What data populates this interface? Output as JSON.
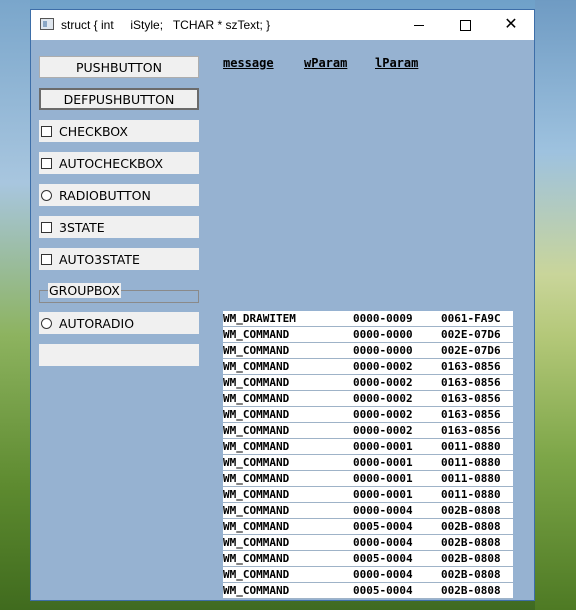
{
  "window": {
    "title": "struct { int     iStyle;   TCHAR * szText; }"
  },
  "controls": [
    {
      "type": "pushbutton",
      "label": "PUSHBUTTON"
    },
    {
      "type": "defpushbutton",
      "label": "DEFPUSHBUTTON"
    },
    {
      "type": "checkbox",
      "label": "CHECKBOX"
    },
    {
      "type": "checkbox",
      "label": "AUTOCHECKBOX"
    },
    {
      "type": "radio",
      "label": "RADIOBUTTON"
    },
    {
      "type": "checkbox",
      "label": "3STATE"
    },
    {
      "type": "checkbox",
      "label": "AUTO3STATE"
    },
    {
      "type": "groupbox",
      "label": "GROUPBOX"
    },
    {
      "type": "radio",
      "label": "AUTORADIO"
    },
    {
      "type": "ownerdraw",
      "label": ""
    }
  ],
  "log": {
    "headers": {
      "message": "message",
      "wparam": "wParam",
      "lparam": "lParam"
    },
    "rows": [
      {
        "message": "WM_DRAWITEM",
        "wparam": "0000-0009",
        "lparam": "0061-FA9C"
      },
      {
        "message": "WM_COMMAND",
        "wparam": "0000-0000",
        "lparam": "002E-07D6"
      },
      {
        "message": "WM_COMMAND",
        "wparam": "0000-0000",
        "lparam": "002E-07D6"
      },
      {
        "message": "WM_COMMAND",
        "wparam": "0000-0002",
        "lparam": "0163-0856"
      },
      {
        "message": "WM_COMMAND",
        "wparam": "0000-0002",
        "lparam": "0163-0856"
      },
      {
        "message": "WM_COMMAND",
        "wparam": "0000-0002",
        "lparam": "0163-0856"
      },
      {
        "message": "WM_COMMAND",
        "wparam": "0000-0002",
        "lparam": "0163-0856"
      },
      {
        "message": "WM_COMMAND",
        "wparam": "0000-0002",
        "lparam": "0163-0856"
      },
      {
        "message": "WM_COMMAND",
        "wparam": "0000-0001",
        "lparam": "0011-0880"
      },
      {
        "message": "WM_COMMAND",
        "wparam": "0000-0001",
        "lparam": "0011-0880"
      },
      {
        "message": "WM_COMMAND",
        "wparam": "0000-0001",
        "lparam": "0011-0880"
      },
      {
        "message": "WM_COMMAND",
        "wparam": "0000-0001",
        "lparam": "0011-0880"
      },
      {
        "message": "WM_COMMAND",
        "wparam": "0000-0004",
        "lparam": "002B-0808"
      },
      {
        "message": "WM_COMMAND",
        "wparam": "0005-0004",
        "lparam": "002B-0808"
      },
      {
        "message": "WM_COMMAND",
        "wparam": "0000-0004",
        "lparam": "002B-0808"
      },
      {
        "message": "WM_COMMAND",
        "wparam": "0005-0004",
        "lparam": "002B-0808"
      },
      {
        "message": "WM_COMMAND",
        "wparam": "0000-0004",
        "lparam": "002B-0808"
      },
      {
        "message": "WM_COMMAND",
        "wparam": "0005-0004",
        "lparam": "002B-0808"
      }
    ]
  }
}
